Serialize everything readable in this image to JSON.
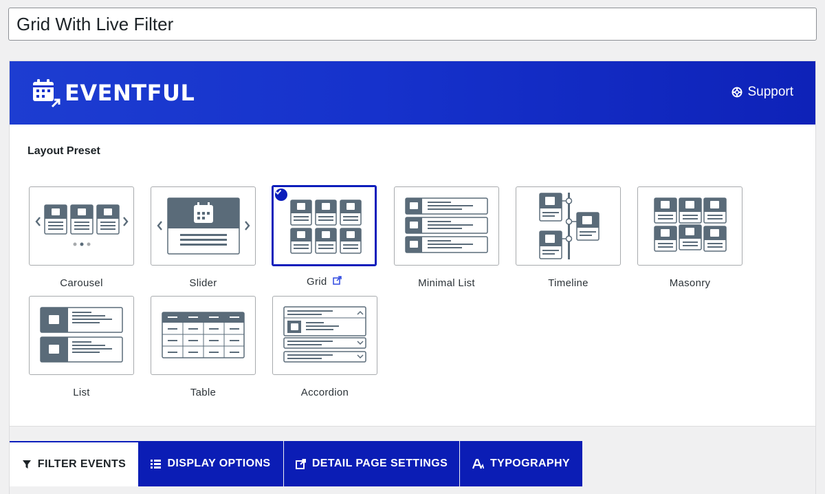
{
  "title_field": {
    "value": "Grid With Live Filter"
  },
  "brand": {
    "name": "EVENTFUL",
    "support_label": "Support"
  },
  "layout_section": {
    "title": "Layout Preset"
  },
  "presets": [
    {
      "label": "Carousel"
    },
    {
      "label": "Slider"
    },
    {
      "label": "Grid",
      "selected": true
    },
    {
      "label": "Minimal List"
    },
    {
      "label": "Timeline"
    },
    {
      "label": "Masonry"
    },
    {
      "label": "List"
    },
    {
      "label": "Table"
    },
    {
      "label": "Accordion"
    }
  ],
  "tabs": [
    {
      "label": "FILTER EVENTS",
      "active": true
    },
    {
      "label": "DISPLAY OPTIONS"
    },
    {
      "label": "DETAIL PAGE SETTINGS"
    },
    {
      "label": "TYPOGRAPHY"
    }
  ],
  "colors": {
    "brand_blue": "#1632cc",
    "tab_blue": "#0b1db5",
    "icon_gray": "#5a6b79"
  }
}
